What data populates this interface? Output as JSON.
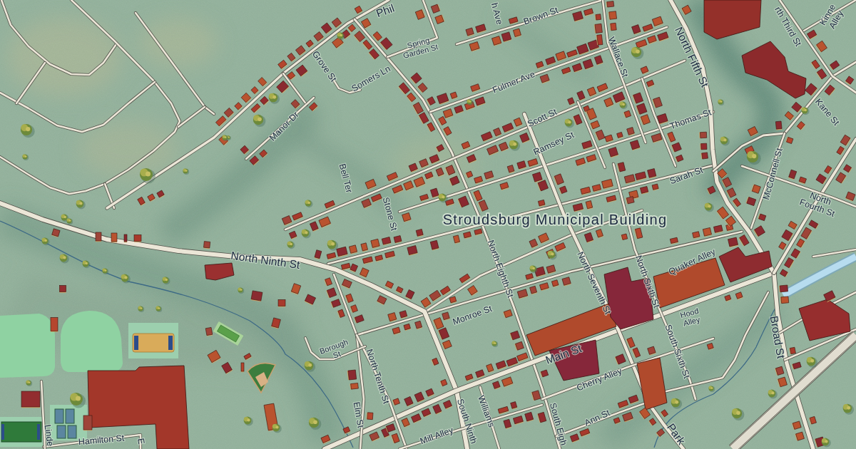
{
  "map": {
    "labels": [
      {
        "kind": "major",
        "lines": [
          "Phil"
        ]
      },
      {
        "kind": "street",
        "lines": [
          "h Ave"
        ]
      },
      {
        "kind": "street",
        "lines": [
          "Brown St"
        ]
      },
      {
        "kind": "street",
        "lines": [
          "rth Third St"
        ]
      },
      {
        "kind": "street",
        "lines": [
          "Kinne",
          "Alley"
        ]
      },
      {
        "kind": "minor",
        "lines": [
          "Spring",
          "Garden St"
        ]
      },
      {
        "kind": "street",
        "lines": [
          "Grove St"
        ]
      },
      {
        "kind": "street",
        "lines": [
          "Somers Ln"
        ]
      },
      {
        "kind": "street",
        "lines": [
          "Fulmer Ave"
        ]
      },
      {
        "kind": "street",
        "lines": [
          "Wallace St"
        ]
      },
      {
        "kind": "major",
        "lines": [
          "North Fifth St"
        ]
      },
      {
        "kind": "street",
        "lines": [
          "Manor Dr"
        ]
      },
      {
        "kind": "street",
        "lines": [
          "Scott St"
        ]
      },
      {
        "kind": "street",
        "lines": [
          "Thomas St"
        ]
      },
      {
        "kind": "street",
        "lines": [
          "Ramsey St"
        ]
      },
      {
        "kind": "street",
        "lines": [
          "Kane St"
        ]
      },
      {
        "kind": "street",
        "lines": [
          "McConnell St"
        ]
      },
      {
        "kind": "street",
        "lines": [
          "Bell Ter"
        ]
      },
      {
        "kind": "street",
        "lines": [
          "Sarah St"
        ]
      },
      {
        "kind": "street",
        "lines": [
          "North",
          "Fourth St"
        ]
      },
      {
        "kind": "street",
        "lines": [
          "Stone St"
        ]
      },
      {
        "kind": "landmark",
        "lines": [
          "Stroudsburg Municipal Building"
        ]
      },
      {
        "kind": "major",
        "lines": [
          "North Ninth St"
        ]
      },
      {
        "kind": "street",
        "lines": [
          "North Eighth St"
        ]
      },
      {
        "kind": "street",
        "lines": [
          "North Seventh St"
        ]
      },
      {
        "kind": "street",
        "lines": [
          "North Sixth St"
        ]
      },
      {
        "kind": "street",
        "lines": [
          "Quaker Alley"
        ]
      },
      {
        "kind": "street",
        "lines": [
          "Monroe St"
        ]
      },
      {
        "kind": "minor",
        "lines": [
          "Hood",
          "Alley"
        ]
      },
      {
        "kind": "major",
        "lines": [
          "Broad St"
        ]
      },
      {
        "kind": "street",
        "lines": [
          "South Sixth St"
        ]
      },
      {
        "kind": "minor",
        "lines": [
          "Borough",
          "St"
        ]
      },
      {
        "kind": "major",
        "lines": [
          "Main St"
        ]
      },
      {
        "kind": "street",
        "lines": [
          "North Tenth St"
        ]
      },
      {
        "kind": "street",
        "lines": [
          "Cherry Alley"
        ]
      },
      {
        "kind": "street",
        "lines": [
          "Elm St"
        ]
      },
      {
        "kind": "street",
        "lines": [
          "Williams"
        ]
      },
      {
        "kind": "street",
        "lines": [
          "Ann St"
        ]
      },
      {
        "kind": "street",
        "lines": [
          "Hamilton St"
        ]
      },
      {
        "kind": "street",
        "lines": [
          "Linde"
        ]
      },
      {
        "kind": "street",
        "lines": [
          "E"
        ]
      },
      {
        "kind": "street",
        "lines": [
          "Mill Alley"
        ]
      },
      {
        "kind": "street",
        "lines": [
          "South Ninth"
        ]
      },
      {
        "kind": "street",
        "lines": [
          "South Eigh"
        ]
      },
      {
        "kind": "major",
        "lines": [
          "Park"
        ]
      }
    ]
  }
}
